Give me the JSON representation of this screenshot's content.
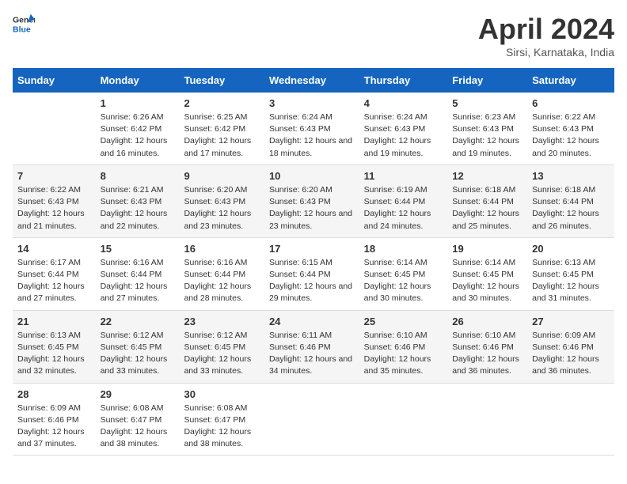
{
  "logo": {
    "text_general": "General",
    "text_blue": "Blue"
  },
  "title": "April 2024",
  "subtitle": "Sirsi, Karnataka, India",
  "weekdays": [
    "Sunday",
    "Monday",
    "Tuesday",
    "Wednesday",
    "Thursday",
    "Friday",
    "Saturday"
  ],
  "weeks": [
    [
      {
        "day": "",
        "sunrise": "",
        "sunset": "",
        "daylight": ""
      },
      {
        "day": "1",
        "sunrise": "Sunrise: 6:26 AM",
        "sunset": "Sunset: 6:42 PM",
        "daylight": "Daylight: 12 hours and 16 minutes."
      },
      {
        "day": "2",
        "sunrise": "Sunrise: 6:25 AM",
        "sunset": "Sunset: 6:42 PM",
        "daylight": "Daylight: 12 hours and 17 minutes."
      },
      {
        "day": "3",
        "sunrise": "Sunrise: 6:24 AM",
        "sunset": "Sunset: 6:43 PM",
        "daylight": "Daylight: 12 hours and 18 minutes."
      },
      {
        "day": "4",
        "sunrise": "Sunrise: 6:24 AM",
        "sunset": "Sunset: 6:43 PM",
        "daylight": "Daylight: 12 hours and 19 minutes."
      },
      {
        "day": "5",
        "sunrise": "Sunrise: 6:23 AM",
        "sunset": "Sunset: 6:43 PM",
        "daylight": "Daylight: 12 hours and 19 minutes."
      },
      {
        "day": "6",
        "sunrise": "Sunrise: 6:22 AM",
        "sunset": "Sunset: 6:43 PM",
        "daylight": "Daylight: 12 hours and 20 minutes."
      }
    ],
    [
      {
        "day": "7",
        "sunrise": "Sunrise: 6:22 AM",
        "sunset": "Sunset: 6:43 PM",
        "daylight": "Daylight: 12 hours and 21 minutes."
      },
      {
        "day": "8",
        "sunrise": "Sunrise: 6:21 AM",
        "sunset": "Sunset: 6:43 PM",
        "daylight": "Daylight: 12 hours and 22 minutes."
      },
      {
        "day": "9",
        "sunrise": "Sunrise: 6:20 AM",
        "sunset": "Sunset: 6:43 PM",
        "daylight": "Daylight: 12 hours and 23 minutes."
      },
      {
        "day": "10",
        "sunrise": "Sunrise: 6:20 AM",
        "sunset": "Sunset: 6:43 PM",
        "daylight": "Daylight: 12 hours and 23 minutes."
      },
      {
        "day": "11",
        "sunrise": "Sunrise: 6:19 AM",
        "sunset": "Sunset: 6:44 PM",
        "daylight": "Daylight: 12 hours and 24 minutes."
      },
      {
        "day": "12",
        "sunrise": "Sunrise: 6:18 AM",
        "sunset": "Sunset: 6:44 PM",
        "daylight": "Daylight: 12 hours and 25 minutes."
      },
      {
        "day": "13",
        "sunrise": "Sunrise: 6:18 AM",
        "sunset": "Sunset: 6:44 PM",
        "daylight": "Daylight: 12 hours and 26 minutes."
      }
    ],
    [
      {
        "day": "14",
        "sunrise": "Sunrise: 6:17 AM",
        "sunset": "Sunset: 6:44 PM",
        "daylight": "Daylight: 12 hours and 27 minutes."
      },
      {
        "day": "15",
        "sunrise": "Sunrise: 6:16 AM",
        "sunset": "Sunset: 6:44 PM",
        "daylight": "Daylight: 12 hours and 27 minutes."
      },
      {
        "day": "16",
        "sunrise": "Sunrise: 6:16 AM",
        "sunset": "Sunset: 6:44 PM",
        "daylight": "Daylight: 12 hours and 28 minutes."
      },
      {
        "day": "17",
        "sunrise": "Sunrise: 6:15 AM",
        "sunset": "Sunset: 6:44 PM",
        "daylight": "Daylight: 12 hours and 29 minutes."
      },
      {
        "day": "18",
        "sunrise": "Sunrise: 6:14 AM",
        "sunset": "Sunset: 6:45 PM",
        "daylight": "Daylight: 12 hours and 30 minutes."
      },
      {
        "day": "19",
        "sunrise": "Sunrise: 6:14 AM",
        "sunset": "Sunset: 6:45 PM",
        "daylight": "Daylight: 12 hours and 30 minutes."
      },
      {
        "day": "20",
        "sunrise": "Sunrise: 6:13 AM",
        "sunset": "Sunset: 6:45 PM",
        "daylight": "Daylight: 12 hours and 31 minutes."
      }
    ],
    [
      {
        "day": "21",
        "sunrise": "Sunrise: 6:13 AM",
        "sunset": "Sunset: 6:45 PM",
        "daylight": "Daylight: 12 hours and 32 minutes."
      },
      {
        "day": "22",
        "sunrise": "Sunrise: 6:12 AM",
        "sunset": "Sunset: 6:45 PM",
        "daylight": "Daylight: 12 hours and 33 minutes."
      },
      {
        "day": "23",
        "sunrise": "Sunrise: 6:12 AM",
        "sunset": "Sunset: 6:45 PM",
        "daylight": "Daylight: 12 hours and 33 minutes."
      },
      {
        "day": "24",
        "sunrise": "Sunrise: 6:11 AM",
        "sunset": "Sunset: 6:46 PM",
        "daylight": "Daylight: 12 hours and 34 minutes."
      },
      {
        "day": "25",
        "sunrise": "Sunrise: 6:10 AM",
        "sunset": "Sunset: 6:46 PM",
        "daylight": "Daylight: 12 hours and 35 minutes."
      },
      {
        "day": "26",
        "sunrise": "Sunrise: 6:10 AM",
        "sunset": "Sunset: 6:46 PM",
        "daylight": "Daylight: 12 hours and 36 minutes."
      },
      {
        "day": "27",
        "sunrise": "Sunrise: 6:09 AM",
        "sunset": "Sunset: 6:46 PM",
        "daylight": "Daylight: 12 hours and 36 minutes."
      }
    ],
    [
      {
        "day": "28",
        "sunrise": "Sunrise: 6:09 AM",
        "sunset": "Sunset: 6:46 PM",
        "daylight": "Daylight: 12 hours and 37 minutes."
      },
      {
        "day": "29",
        "sunrise": "Sunrise: 6:08 AM",
        "sunset": "Sunset: 6:47 PM",
        "daylight": "Daylight: 12 hours and 38 minutes."
      },
      {
        "day": "30",
        "sunrise": "Sunrise: 6:08 AM",
        "sunset": "Sunset: 6:47 PM",
        "daylight": "Daylight: 12 hours and 38 minutes."
      },
      {
        "day": "",
        "sunrise": "",
        "sunset": "",
        "daylight": ""
      },
      {
        "day": "",
        "sunrise": "",
        "sunset": "",
        "daylight": ""
      },
      {
        "day": "",
        "sunrise": "",
        "sunset": "",
        "daylight": ""
      },
      {
        "day": "",
        "sunrise": "",
        "sunset": "",
        "daylight": ""
      }
    ]
  ]
}
